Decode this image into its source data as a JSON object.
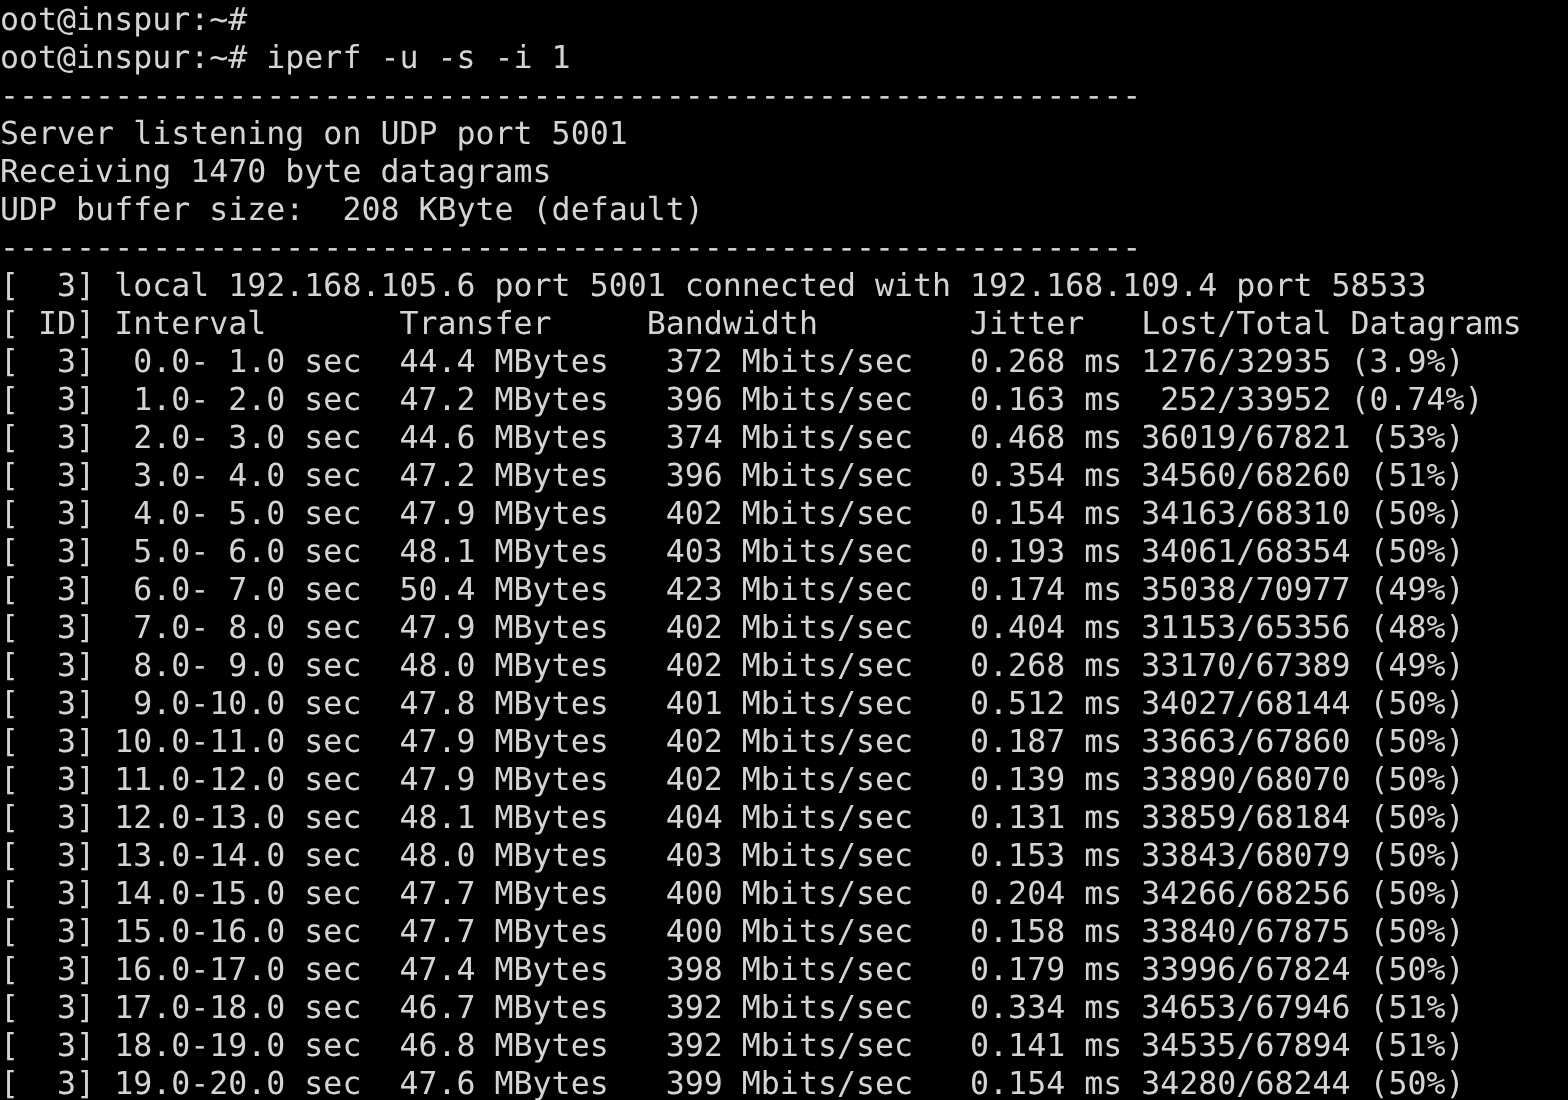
{
  "terminal": {
    "lines": [
      "oot@inspur:~#",
      "oot@inspur:~# iperf -u -s -i 1",
      "------------------------------------------------------------",
      "Server listening on UDP port 5001",
      "Receiving 1470 byte datagrams",
      "UDP buffer size:  208 KByte (default)",
      "------------------------------------------------------------",
      "[  3] local 192.168.105.6 port 5001 connected with 192.168.109.4 port 58533",
      "[ ID] Interval       Transfer     Bandwidth        Jitter   Lost/Total Datagrams",
      "[  3]  0.0- 1.0 sec  44.4 MBytes   372 Mbits/sec   0.268 ms 1276/32935 (3.9%)",
      "[  3]  1.0- 2.0 sec  47.2 MBytes   396 Mbits/sec   0.163 ms  252/33952 (0.74%)",
      "[  3]  2.0- 3.0 sec  44.6 MBytes   374 Mbits/sec   0.468 ms 36019/67821 (53%)",
      "[  3]  3.0- 4.0 sec  47.2 MBytes   396 Mbits/sec   0.354 ms 34560/68260 (51%)",
      "[  3]  4.0- 5.0 sec  47.9 MBytes   402 Mbits/sec   0.154 ms 34163/68310 (50%)",
      "[  3]  5.0- 6.0 sec  48.1 MBytes   403 Mbits/sec   0.193 ms 34061/68354 (50%)",
      "[  3]  6.0- 7.0 sec  50.4 MBytes   423 Mbits/sec   0.174 ms 35038/70977 (49%)",
      "[  3]  7.0- 8.0 sec  47.9 MBytes   402 Mbits/sec   0.404 ms 31153/65356 (48%)",
      "[  3]  8.0- 9.0 sec  48.0 MBytes   402 Mbits/sec   0.268 ms 33170/67389 (49%)",
      "[  3]  9.0-10.0 sec  47.8 MBytes   401 Mbits/sec   0.512 ms 34027/68144 (50%)",
      "[  3] 10.0-11.0 sec  47.9 MBytes   402 Mbits/sec   0.187 ms 33663/67860 (50%)",
      "[  3] 11.0-12.0 sec  47.9 MBytes   402 Mbits/sec   0.139 ms 33890/68070 (50%)",
      "[  3] 12.0-13.0 sec  48.1 MBytes   404 Mbits/sec   0.131 ms 33859/68184 (50%)",
      "[  3] 13.0-14.0 sec  48.0 MBytes   403 Mbits/sec   0.153 ms 33843/68079 (50%)",
      "[  3] 14.0-15.0 sec  47.7 MBytes   400 Mbits/sec   0.204 ms 34266/68256 (50%)",
      "[  3] 15.0-16.0 sec  47.7 MBytes   400 Mbits/sec   0.158 ms 33840/67875 (50%)",
      "[  3] 16.0-17.0 sec  47.4 MBytes   398 Mbits/sec   0.179 ms 33996/67824 (50%)",
      "[  3] 17.0-18.0 sec  46.7 MBytes   392 Mbits/sec   0.334 ms 34653/67946 (51%)",
      "[  3] 18.0-19.0 sec  46.8 MBytes   392 Mbits/sec   0.141 ms 34535/67894 (51%)",
      "[  3] 19.0-20.0 sec  47.6 MBytes   399 Mbits/sec   0.154 ms 34280/68244 (50%)"
    ]
  }
}
